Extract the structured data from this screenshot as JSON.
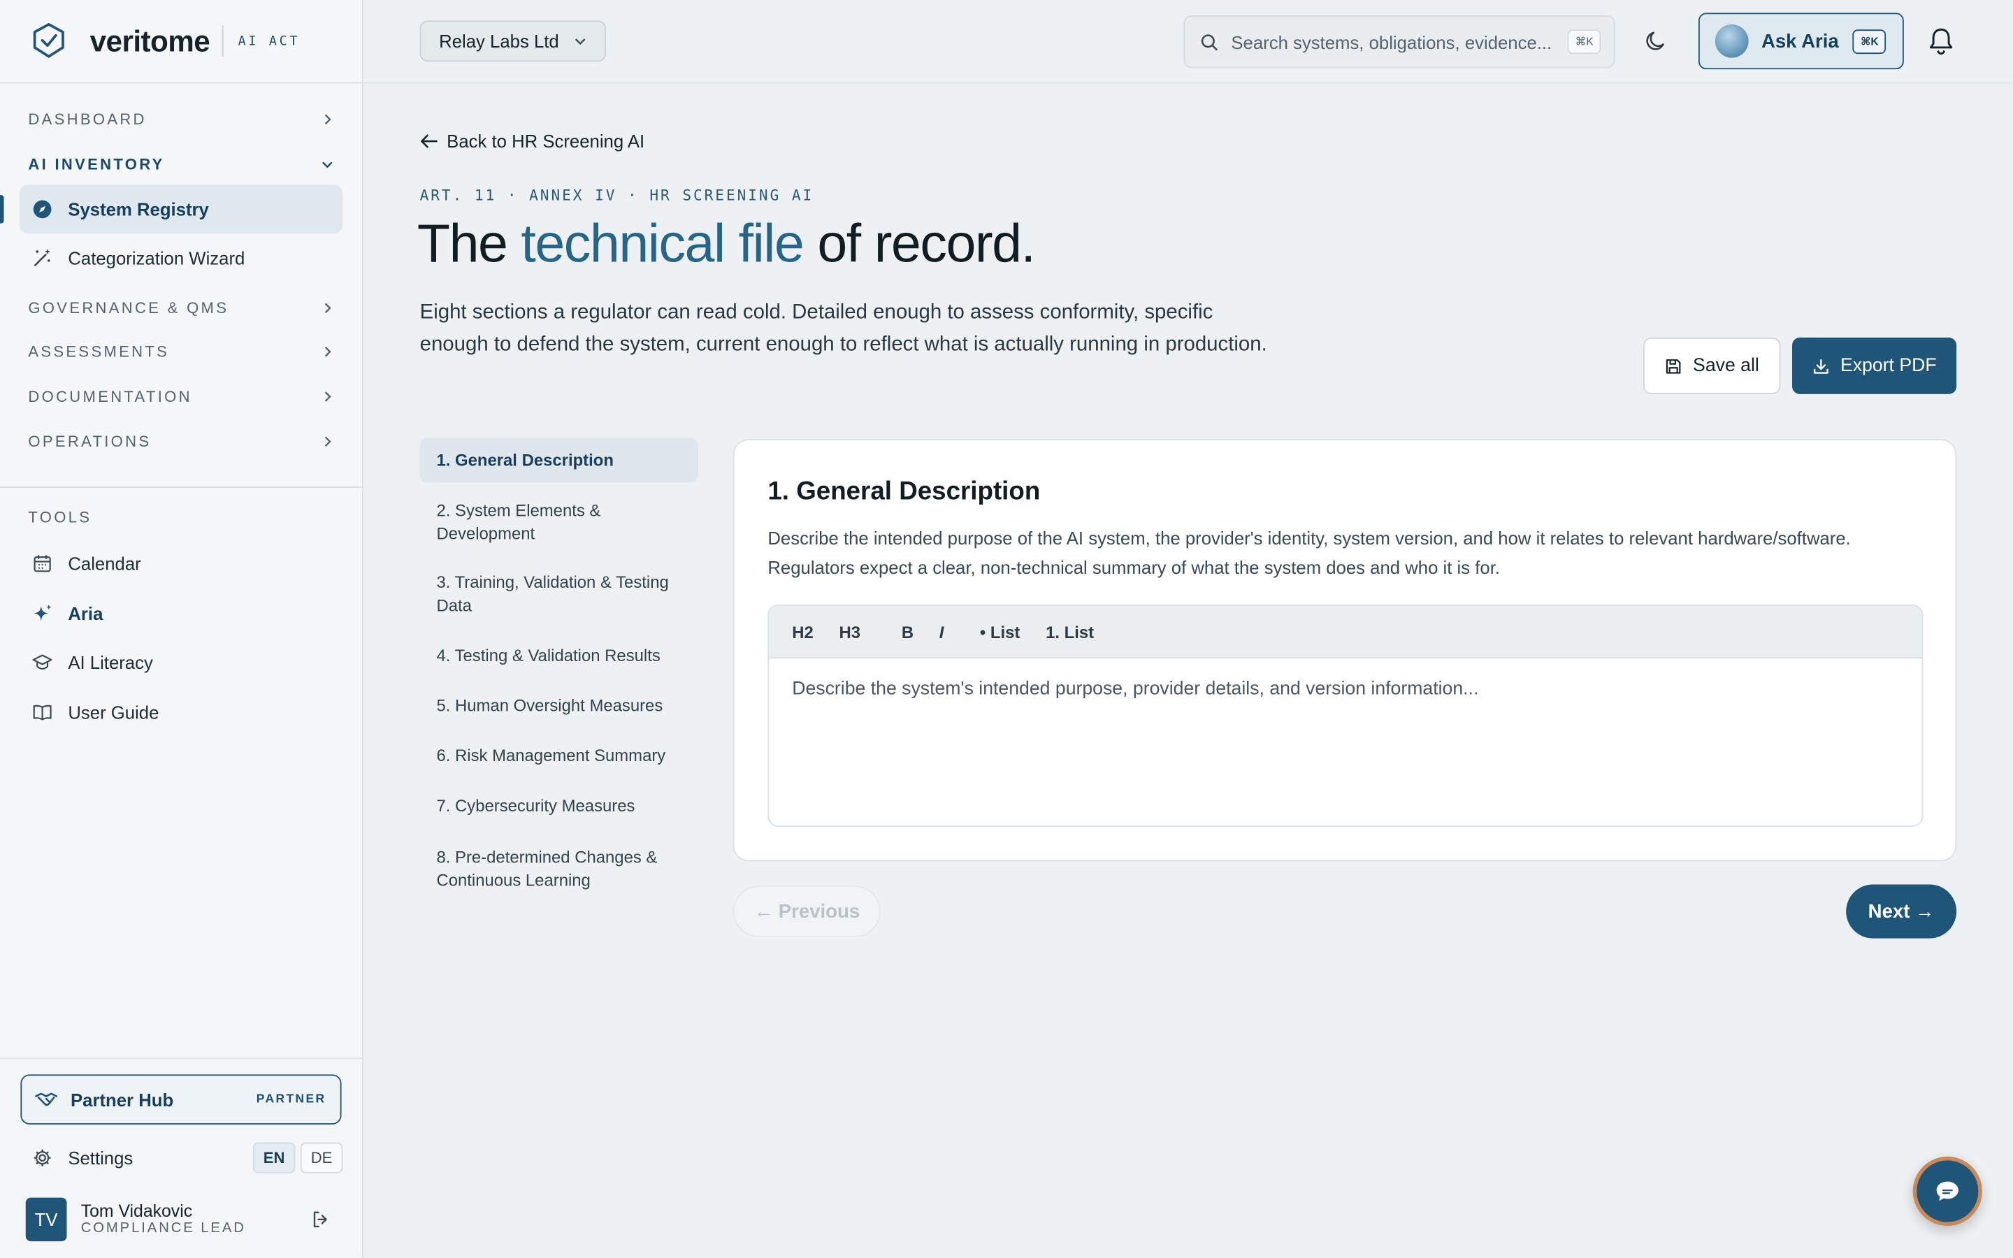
{
  "brand": {
    "name": "veritome",
    "tag": "AI ACT"
  },
  "sidebar": {
    "sections": {
      "dashboard": "DASHBOARD",
      "inventory": "AI INVENTORY",
      "governance": "GOVERNANCE & QMS",
      "assessments": "ASSESSMENTS",
      "documentation": "DOCUMENTATION",
      "operations": "OPERATIONS"
    },
    "inventory_items": {
      "registry": "System Registry",
      "wizard": "Categorization Wizard"
    },
    "tools_label": "TOOLS",
    "tools": {
      "calendar": "Calendar",
      "aria": "Aria",
      "literacy": "AI Literacy",
      "guide": "User Guide"
    },
    "partner": {
      "label": "Partner Hub",
      "badge": "PARTNER"
    },
    "settings": "Settings",
    "languages": {
      "en": "EN",
      "de": "DE"
    },
    "user": {
      "initials": "TV",
      "name": "Tom Vidakovic",
      "role": "COMPLIANCE LEAD"
    }
  },
  "topbar": {
    "org": "Relay Labs Ltd",
    "search_placeholder": "Search systems, obligations, evidence...",
    "search_shortcut": "⌘K",
    "ask_label": "Ask Aria",
    "ask_shortcut": "⌘K"
  },
  "page": {
    "back": "Back to HR Screening AI",
    "eyebrow": "ART. 11 · ANNEX IV · HR SCREENING AI",
    "title_pre": "The ",
    "title_accent": "technical file",
    "title_post": " of record.",
    "lead": "Eight sections a regulator can read cold. Detailed enough to assess conformity, specific enough to defend the system, current enough to reflect what is actually running in production.",
    "save_all": "Save all",
    "export_pdf": "Export PDF"
  },
  "toc": [
    "1. General Description",
    "2. System Elements & Development",
    "3. Training, Validation & Testing Data",
    "4. Testing & Validation Results",
    "5. Human Oversight Measures",
    "6. Risk Management Summary",
    "7. Cybersecurity Measures",
    "8. Pre-determined Changes & Continuous Learning"
  ],
  "section": {
    "title": "1. General Description",
    "description": "Describe the intended purpose of the AI system, the provider's identity, system version, and how it relates to relevant hardware/software. Regulators expect a clear, non-technical summary of what the system does and who it is for.",
    "toolbar": {
      "h2": "H2",
      "h3": "H3",
      "bold": "B",
      "italic": "I",
      "bullet": "• List",
      "numbered": "1. List"
    },
    "editor_placeholder": "Describe the system's intended purpose, provider details, and version information...",
    "editor_value": ""
  },
  "pager": {
    "previous": "← Previous",
    "next": "Next →"
  },
  "colors": {
    "accent": "#1e5578",
    "background": "#edf1f3"
  }
}
